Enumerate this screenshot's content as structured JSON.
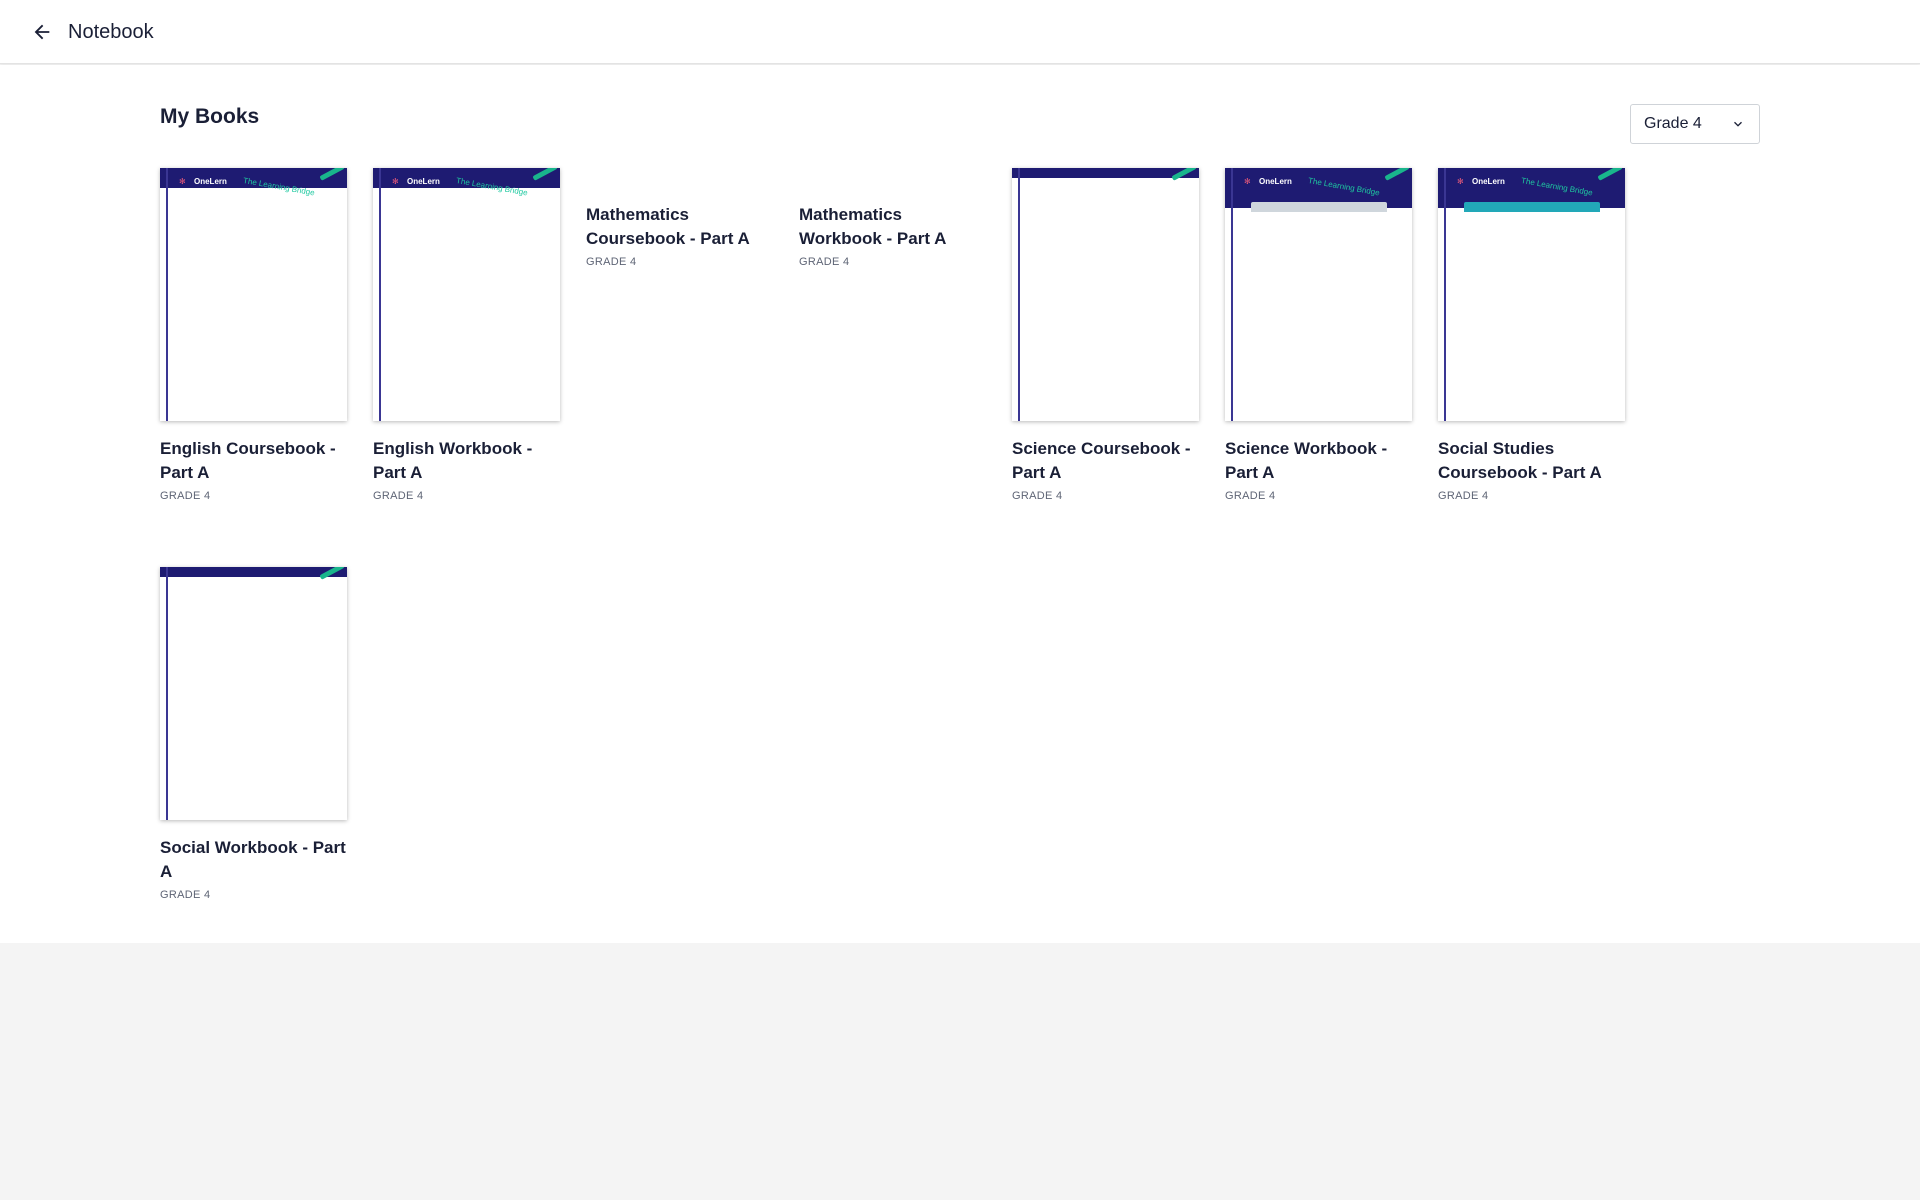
{
  "header": {
    "back_icon": "arrow-left-icon",
    "title": "Notebook"
  },
  "main": {
    "section_title": "My Books",
    "grade_filter": {
      "selected": "Grade 4",
      "icon": "chevron-down-icon"
    }
  },
  "cover_brand": {
    "logo": "OneLern",
    "tagline": "The Learning Bridge",
    "band_color": "#1e1b72",
    "accent_color": "#1fc9a0"
  },
  "books": [
    {
      "title": "English Coursebook - Part A",
      "grade": "GRADE 4"
    },
    {
      "title": "English Workbook - Part A",
      "grade": "GRADE 4"
    },
    {
      "title": "Mathematics Coursebook - Part A",
      "grade": "GRADE 4"
    },
    {
      "title": "Mathematics Workbook - Part A",
      "grade": "GRADE 4"
    },
    {
      "title": "Science Coursebook - Part A",
      "grade": "GRADE 4"
    },
    {
      "title": "Science Workbook - Part A",
      "grade": "GRADE 4"
    },
    {
      "title": "Social Studies Coursebook - Part A",
      "grade": "GRADE 4"
    },
    {
      "title": "Social Workbook - Part A",
      "grade": "GRADE 4"
    }
  ]
}
